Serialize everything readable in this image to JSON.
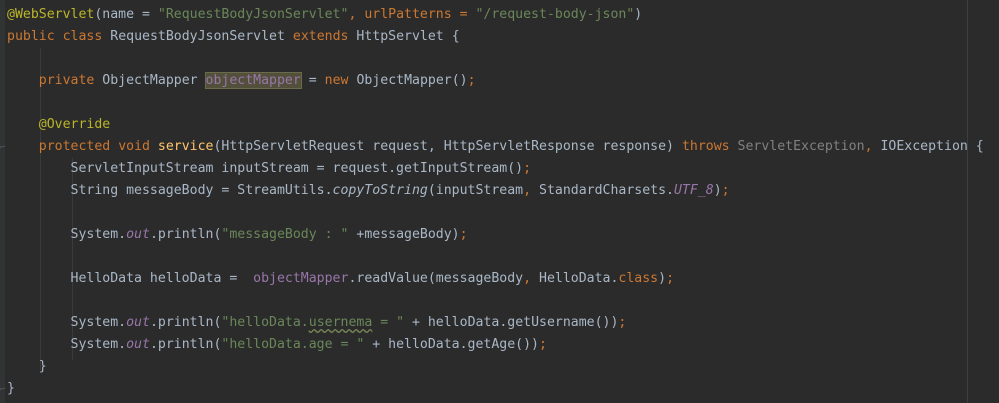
{
  "editor": {
    "colors": {
      "background": "#2b2b2b",
      "annotation": "#bbb529",
      "keyword": "#cc7832",
      "string": "#6a8759",
      "method_declaration": "#ffc66d",
      "static_field": "#9876aa",
      "plain": "#a9b7c6",
      "unused": "#808080"
    },
    "code": {
      "l1": {
        "annotation": "@WebServlet",
        "open": "(name = ",
        "name_value": "\"RequestBodyJsonServlet\"",
        "mid": ", urlPatterns = ",
        "url_value": "\"/request-body-json\"",
        "close": ")"
      },
      "l2": {
        "kw_public": "public",
        "kw_class": "class",
        "class_name": "RequestBodyJsonServlet",
        "kw_extends": "extends",
        "parent": "HttpServlet",
        "brace": "{"
      },
      "l4": {
        "kw_private": "private",
        "type": "ObjectMapper",
        "field": "objectMapper",
        "eq": "=",
        "kw_new": "new",
        "ctor": "ObjectMapper()",
        "semi": ";"
      },
      "l6": {
        "annotation": "@Override"
      },
      "l7": {
        "kw_protected": "protected",
        "kw_void": "void",
        "method": "service",
        "params": "(HttpServletRequest request, HttpServletResponse response)",
        "kw_throws": "throws",
        "ex1": "ServletException",
        "comma": ",",
        "ex2": "IOException {"
      },
      "l8": {
        "text": "ServletInputStream inputStream = request.getInputStream()",
        "semi": ";"
      },
      "l9": {
        "pre": "String messageBody = StreamUtils.",
        "call": "copyToString",
        "args": "(inputStream",
        "comma": ",",
        "mid": " StandardCharsets.",
        "const": "UTF_8",
        "end": ")",
        "semi": ";"
      },
      "l11": {
        "pre": "System.",
        "out": "out",
        "call": ".println(",
        "str": "\"messageBody : \"",
        "rest": " +messageBody)",
        "semi": ";"
      },
      "l13": {
        "pre": "HelloData helloData =  ",
        "field": "objectMapper",
        "call": ".readValue(messageBody",
        "comma": ",",
        "mid": " HelloData.",
        "kw_class": "class",
        "end": ")",
        "semi": ";"
      },
      "l15": {
        "pre": "System.",
        "out": "out",
        "call": ".println(",
        "str_a": "\"helloData.",
        "str_typo": "usernema",
        "str_b": " = \"",
        "rest": " + helloData.getUsername())",
        "semi": ";"
      },
      "l16": {
        "pre": "System.",
        "out": "out",
        "call": ".println(",
        "str": "\"helloData.age = \"",
        "rest": " + helloData.getAge())",
        "semi": ";"
      },
      "l17": {
        "brace": "}"
      },
      "l18": {
        "brace": "}"
      }
    }
  }
}
